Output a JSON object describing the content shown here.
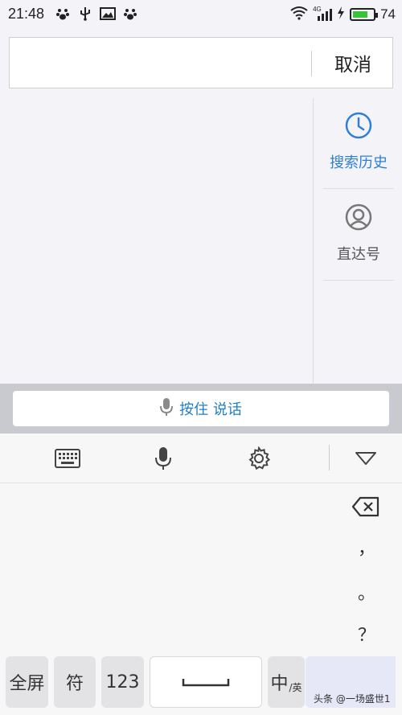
{
  "status_bar": {
    "time": "21:48",
    "network": "4G",
    "battery_level": "74",
    "battery_fraction": 0.74,
    "battery_color": "#3ac23a",
    "icons": [
      "paw-icon",
      "usb-icon",
      "image-icon",
      "paw-icon",
      "wifi-icon",
      "signal-icon",
      "charging-icon",
      "battery-icon"
    ]
  },
  "search": {
    "value": "",
    "placeholder": "",
    "cancel_label": "取消"
  },
  "side_panel": {
    "items": [
      {
        "label": "搜索历史",
        "icon": "clock-icon",
        "color": "#2f7fd6",
        "active": true
      },
      {
        "label": "直达号",
        "icon": "user-circle-icon",
        "color": "#555555",
        "active": false
      }
    ]
  },
  "voice": {
    "label": "按住 说话",
    "color": "#1f7fc7"
  },
  "keyboard": {
    "toolbar_icons": [
      "keyboard-icon",
      "mic-icon",
      "gear-icon",
      "collapse-triangle-icon"
    ],
    "punctuation": [
      "，",
      "。",
      "？"
    ],
    "bottom_keys": {
      "fullscreen": "全屏",
      "symbols": "符",
      "numbers": "123",
      "lang_main": "中",
      "lang_sub": "/英"
    }
  },
  "watermark": "头条 @一场盛世1"
}
